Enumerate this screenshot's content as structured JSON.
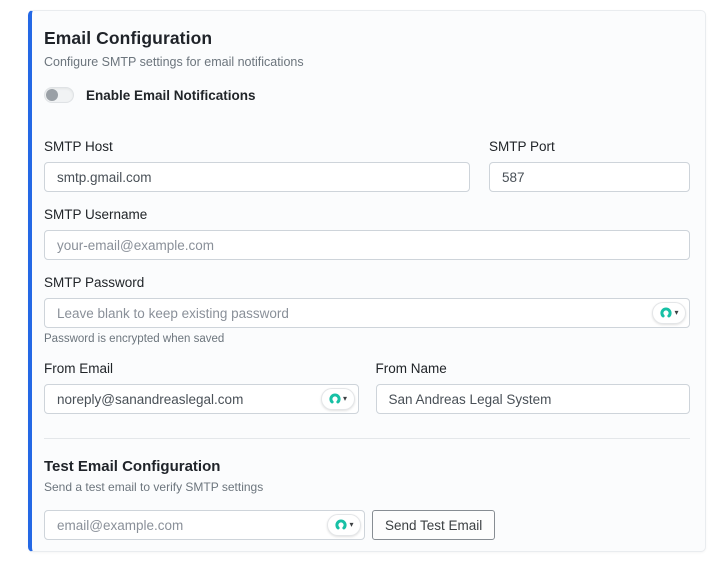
{
  "colors": {
    "accent_blue": "#2468e5",
    "teal_logo": "#17c0a5"
  },
  "card": {
    "header": {
      "title": "Email Configuration",
      "subtitle": "Configure SMTP settings for email notifications"
    },
    "toggle": {
      "label": "Enable Email Notifications",
      "enabled": false
    },
    "fields": {
      "smtp_host": {
        "label": "SMTP Host",
        "value": "smtp.gmail.com"
      },
      "smtp_port": {
        "label": "SMTP Port",
        "value": "587"
      },
      "smtp_username": {
        "label": "SMTP Username",
        "placeholder": "your-email@example.com"
      },
      "smtp_password": {
        "label": "SMTP Password",
        "placeholder": "Leave blank to keep existing password",
        "helper": "Password is encrypted when saved"
      },
      "from_email": {
        "label": "From Email",
        "value": "noreply@sanandreaslegal.com"
      },
      "from_name": {
        "label": "From Name",
        "value": "San Andreas Legal System"
      }
    },
    "test_section": {
      "title": "Test Email Configuration",
      "subtitle": "Send a test email to verify SMTP settings",
      "email_placeholder": "email@example.com",
      "button_label": "Send Test Email"
    }
  },
  "icons": {
    "password_manager": "nordpass-autofill-icon",
    "chevron_glyph": "▾"
  }
}
